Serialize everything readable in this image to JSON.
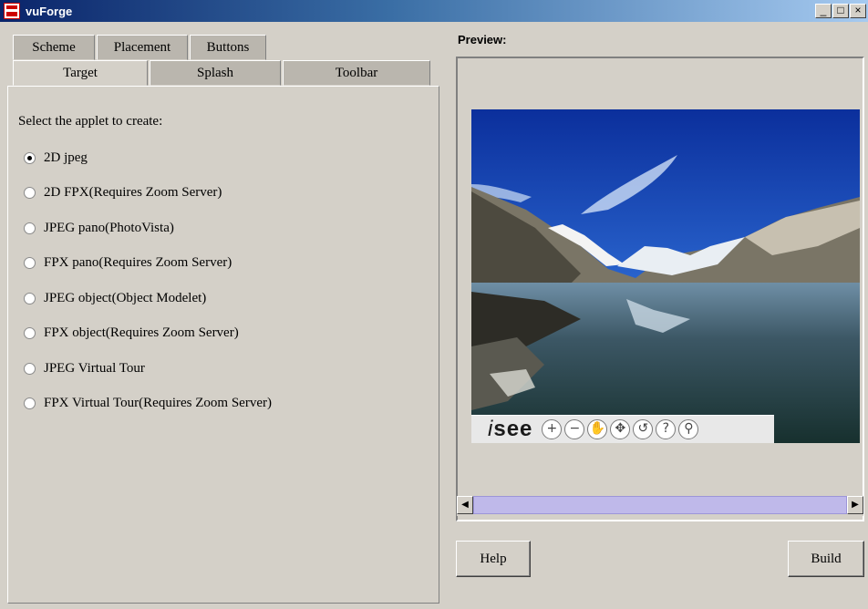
{
  "window": {
    "title": "vuForge",
    "controls": [
      "_",
      "□",
      "×"
    ]
  },
  "tabs": {
    "row1": [
      "Scheme",
      "Placement",
      "Buttons"
    ],
    "row2": [
      "Target",
      "Splash",
      "Toolbar"
    ],
    "active": "Target"
  },
  "target": {
    "prompt": "Select the applet to create:",
    "options": [
      {
        "label": "2D jpeg",
        "checked": true
      },
      {
        "label": "2D FPX(Requires Zoom Server)",
        "checked": false
      },
      {
        "label": "JPEG pano(PhotoVista)",
        "checked": false
      },
      {
        "label": "FPX pano(Requires Zoom Server)",
        "checked": false
      },
      {
        "label": "JPEG object(Object Modelet)",
        "checked": false
      },
      {
        "label": "FPX object(Requires Zoom Server)",
        "checked": false
      },
      {
        "label": "JPEG Virtual Tour",
        "checked": false
      },
      {
        "label": "FPX Virtual Tour(Requires Zoom Server)",
        "checked": false
      }
    ]
  },
  "preview": {
    "label": "Preview:",
    "logo_prefix": "i",
    "logo_suffix": "see",
    "tools": [
      {
        "icon": "zoom-in-icon",
        "glyph": "+"
      },
      {
        "icon": "zoom-out-icon",
        "glyph": "−"
      },
      {
        "icon": "pan-hand-icon",
        "glyph": "✋"
      },
      {
        "icon": "move-icon",
        "glyph": "✥"
      },
      {
        "icon": "reset-icon",
        "glyph": "↺"
      },
      {
        "icon": "help-icon",
        "glyph": "?"
      },
      {
        "icon": "info-icon",
        "glyph": "⚲"
      }
    ]
  },
  "buttons": {
    "help": "Help",
    "build": "Build"
  }
}
